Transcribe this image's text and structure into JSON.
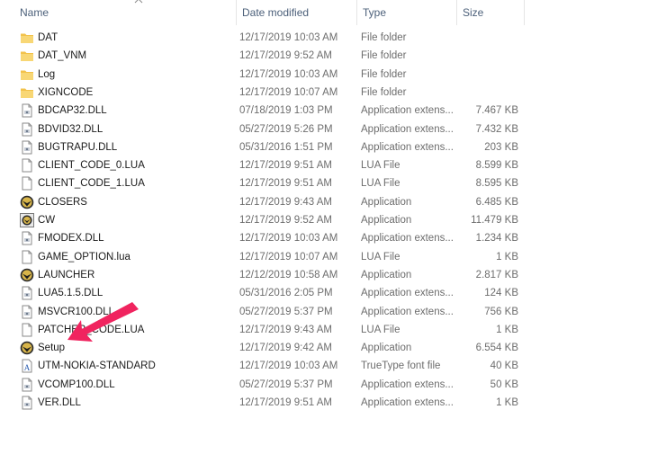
{
  "columns": {
    "name": "Name",
    "date": "Date modified",
    "type": "Type",
    "size": "Size"
  },
  "rows": [
    {
      "name": "DAT",
      "date": "12/17/2019 10:03 AM",
      "type": "File folder",
      "size": "",
      "icon": "folder-icon"
    },
    {
      "name": "DAT_VNM",
      "date": "12/17/2019 9:52 AM",
      "type": "File folder",
      "size": "",
      "icon": "folder-icon"
    },
    {
      "name": "Log",
      "date": "12/17/2019 10:03 AM",
      "type": "File folder",
      "size": "",
      "icon": "folder-icon"
    },
    {
      "name": "XIGNCODE",
      "date": "12/17/2019 10:07 AM",
      "type": "File folder",
      "size": "",
      "icon": "folder-icon"
    },
    {
      "name": "BDCAP32.DLL",
      "date": "07/18/2019 1:03 PM",
      "type": "Application extens...",
      "size": "7.467 KB",
      "icon": "dll-icon"
    },
    {
      "name": "BDVID32.DLL",
      "date": "05/27/2019 5:26 PM",
      "type": "Application extens...",
      "size": "7.432 KB",
      "icon": "dll-icon"
    },
    {
      "name": "BUGTRAPU.DLL",
      "date": "05/31/2016 1:51 PM",
      "type": "Application extens...",
      "size": "203 KB",
      "icon": "dll-icon"
    },
    {
      "name": "CLIENT_CODE_0.LUA",
      "date": "12/17/2019 9:51 AM",
      "type": "LUA File",
      "size": "8.599 KB",
      "icon": "file-icon"
    },
    {
      "name": "CLIENT_CODE_1.LUA",
      "date": "12/17/2019 9:51 AM",
      "type": "LUA File",
      "size": "8.595 KB",
      "icon": "file-icon"
    },
    {
      "name": "CLOSERS",
      "date": "12/17/2019 9:43 AM",
      "type": "Application",
      "size": "6.485 KB",
      "icon": "closers-app-icon"
    },
    {
      "name": "CW",
      "date": "12/17/2019 9:52 AM",
      "type": "Application",
      "size": "11.479 KB",
      "icon": "cw-app-icon"
    },
    {
      "name": "FMODEX.DLL",
      "date": "12/17/2019 10:03 AM",
      "type": "Application extens...",
      "size": "1.234 KB",
      "icon": "dll-icon"
    },
    {
      "name": "GAME_OPTION.lua",
      "date": "12/17/2019 10:07 AM",
      "type": "LUA File",
      "size": "1 KB",
      "icon": "file-icon"
    },
    {
      "name": "LAUNCHER",
      "date": "12/12/2019 10:58 AM",
      "type": "Application",
      "size": "2.817 KB",
      "icon": "closers-app-icon"
    },
    {
      "name": "LUA5.1.5.DLL",
      "date": "05/31/2016 2:05 PM",
      "type": "Application extens...",
      "size": "124 KB",
      "icon": "dll-icon"
    },
    {
      "name": "MSVCR100.DLL",
      "date": "05/27/2019 5:37 PM",
      "type": "Application extens...",
      "size": "756 KB",
      "icon": "dll-icon"
    },
    {
      "name": "PATCHER_CODE.LUA",
      "date": "12/17/2019 9:43 AM",
      "type": "LUA File",
      "size": "1 KB",
      "icon": "file-icon"
    },
    {
      "name": "Setup",
      "date": "12/17/2019 9:42 AM",
      "type": "Application",
      "size": "6.554 KB",
      "icon": "closers-app-icon"
    },
    {
      "name": "UTM-NOKIA-STANDARD",
      "date": "12/17/2019 10:03 AM",
      "type": "TrueType font file",
      "size": "40 KB",
      "icon": "font-icon"
    },
    {
      "name": "VCOMP100.DLL",
      "date": "05/27/2019 5:37 PM",
      "type": "Application extens...",
      "size": "50 KB",
      "icon": "dll-icon"
    },
    {
      "name": "VER.DLL",
      "date": "12/17/2019 9:51 AM",
      "type": "Application extens...",
      "size": "1 KB",
      "icon": "dll-icon"
    }
  ],
  "annotation": {
    "arrow_color": "#f0245f",
    "arrow_target": "Setup"
  },
  "colors": {
    "folder": "#f2c24b",
    "header_text": "#4c607a"
  }
}
